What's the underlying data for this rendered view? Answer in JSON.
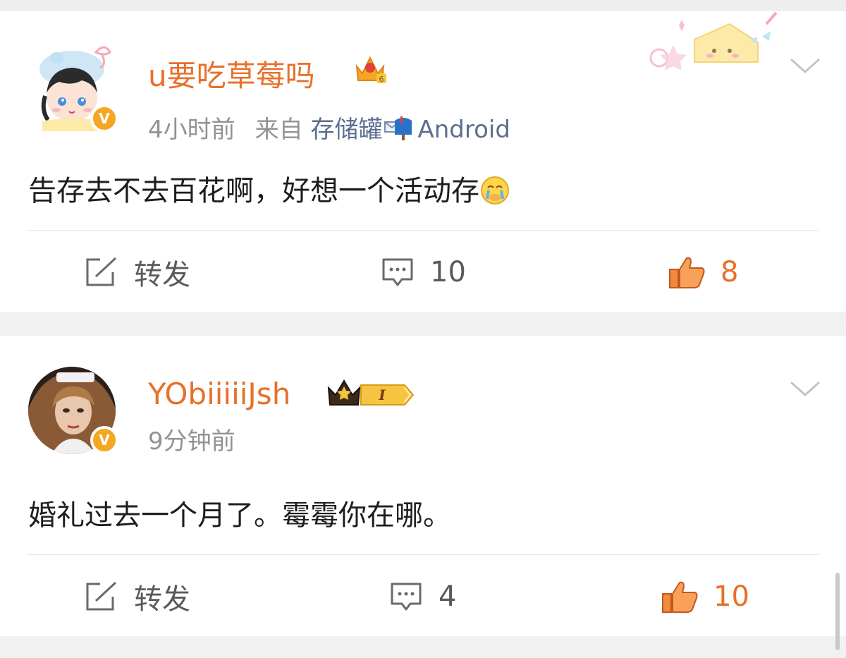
{
  "posts": [
    {
      "username": "u要吃草莓吗",
      "time": "4小时前",
      "from_label": "来自",
      "source_before": "存储罐",
      "source_after": "Android",
      "content": "告存去不去百花啊，好想一个活动存",
      "verified_badge": "V",
      "crown_level": "6",
      "repost_label": "转发",
      "comment_count": "10",
      "like_count": "8"
    },
    {
      "username": "YObiiiiiJsh",
      "time": "9分钟前",
      "content": "婚礼过去一个月了。霉霉你在哪。",
      "verified_badge": "V",
      "crown_level": "I",
      "repost_label": "转发",
      "comment_count": "4",
      "like_count": "10"
    }
  ],
  "colors": {
    "username": "#e8702a",
    "meta": "#939393",
    "source_link": "#5b6f8f",
    "like_accent": "#e8702a",
    "badge": "#f5a623"
  },
  "icons": [
    "chevron-down-icon",
    "repost-icon",
    "comment-icon",
    "thumbs-up-icon",
    "crown-icon",
    "mailbox-icon",
    "crying-emoji-icon"
  ]
}
